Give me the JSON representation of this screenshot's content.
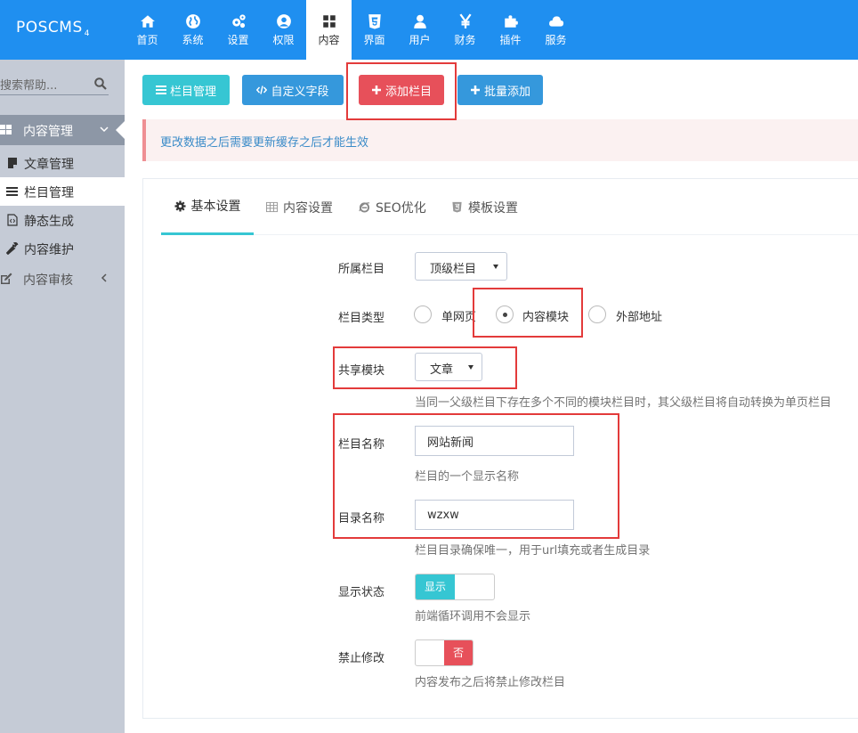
{
  "app": {
    "logo": "POSCMS",
    "logo_version": "4"
  },
  "nav": [
    {
      "label": "首页",
      "icon": "home-icon"
    },
    {
      "label": "系统",
      "icon": "globe-icon"
    },
    {
      "label": "设置",
      "icon": "cogs-icon"
    },
    {
      "label": "权限",
      "icon": "user-circle-icon"
    },
    {
      "label": "内容",
      "icon": "grid-icon",
      "active": true
    },
    {
      "label": "界面",
      "icon": "html5-icon"
    },
    {
      "label": "用户",
      "icon": "user-icon"
    },
    {
      "label": "财务",
      "icon": "yen-icon"
    },
    {
      "label": "插件",
      "icon": "puzzle-icon"
    },
    {
      "label": "服务",
      "icon": "cloud-icon"
    }
  ],
  "sidebar": {
    "search_placeholder": "搜索帮助...",
    "group_label": "内容管理",
    "items": [
      {
        "label": "文章管理",
        "icon": "note-icon"
      },
      {
        "label": "栏目管理",
        "icon": "list-icon",
        "active": true
      },
      {
        "label": "静态生成",
        "icon": "code-file-icon"
      },
      {
        "label": "内容维护",
        "icon": "wrench-icon"
      }
    ],
    "group2_label": "内容审核"
  },
  "toolbar": {
    "column_manage": "栏目管理",
    "custom_fields": "自定义字段",
    "add_column": "添加栏目",
    "batch_add": "批量添加"
  },
  "alert": {
    "text": "更改数据之后需要更新缓存之后才能生效"
  },
  "tabs": [
    {
      "label": "基本设置",
      "icon": "gear-icon",
      "active": true
    },
    {
      "label": "内容设置",
      "icon": "table-icon"
    },
    {
      "label": "SEO优化",
      "icon": "ie-icon"
    },
    {
      "label": "模板设置",
      "icon": "html5-icon"
    }
  ],
  "form": {
    "parent": {
      "label": "所属栏目",
      "value": "顶级栏目"
    },
    "type": {
      "label": "栏目类型",
      "options": [
        "单网页",
        "内容模块",
        "外部地址"
      ],
      "selected": "内容模块"
    },
    "module": {
      "label": "共享模块",
      "value": "文章",
      "help": "当同一父级栏目下存在多个不同的模块栏目时，其父级栏目将自动转换为单页栏目"
    },
    "name": {
      "label": "栏目名称",
      "value": "网站新闻",
      "help": "栏目的一个显示名称"
    },
    "dir": {
      "label": "目录名称",
      "value": "wzxw",
      "help": "栏目目录确保唯一，用于url填充或者生成目录"
    },
    "show": {
      "label": "显示状态",
      "switch_text": "显示",
      "state": "on",
      "help": "前端循环调用不会显示"
    },
    "lock": {
      "label": "禁止修改",
      "switch_text": "否",
      "state": "off",
      "help": "内容发布之后将禁止修改栏目"
    }
  },
  "colors": {
    "topbar": "#1f8ff0",
    "cyan": "#36c6d3",
    "blue": "#3598dc",
    "red": "#e7505a",
    "sidebar": "#c5cbd6",
    "highlight_box": "#e33b3b"
  }
}
